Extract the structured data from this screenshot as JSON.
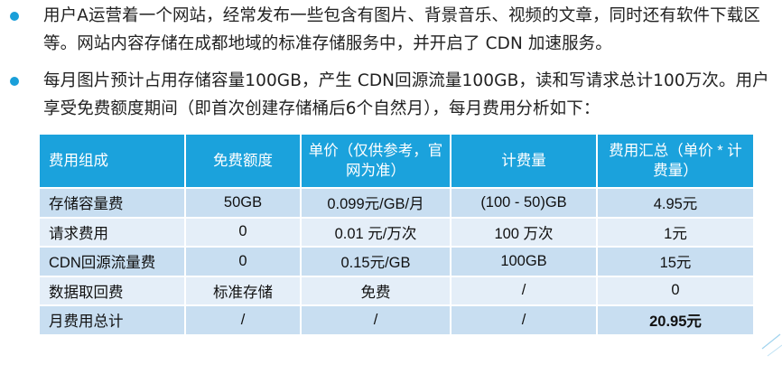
{
  "bullets": [
    "用户A运营着一个网站，经常发布一些包含有图片、背景音乐、视频的文章，同时还有软件下载区等。网站内容存储在成都地域的标准存储服务中，并开启了 CDN 加速服务。",
    "每月图片预计占用存储容量100GB，产生 CDN回源流量100GB，读和写请求总计100万次。用户享受免费额度期间（即首次创建存储桶后6个自然月），每月费用分析如下："
  ],
  "table": {
    "headers": [
      "费用组成",
      "免费额度",
      "单价（仅供参考，官网为准）",
      "计费量",
      "费用汇总（单价 * 计费量）"
    ],
    "rows": [
      [
        "存储容量费",
        "50GB",
        "0.099元/GB/月",
        "(100 - 50)GB",
        "4.95元"
      ],
      [
        "请求费用",
        "0",
        "0.01 元/万次",
        "100 万次",
        "1元"
      ],
      [
        "CDN回源流量费",
        "0",
        "0.15元/GB",
        "100GB",
        "15元"
      ],
      [
        "数据取回费",
        "标准存储",
        "免费",
        "/",
        "0"
      ],
      [
        "月费用总计",
        "/",
        "/",
        "/",
        "20.95元"
      ]
    ]
  },
  "colors": {
    "accent": "#1ba2dc",
    "row_odd": "#c8def1",
    "row_even": "#e4eef8",
    "bullet_dot": "#1a9fd9"
  }
}
